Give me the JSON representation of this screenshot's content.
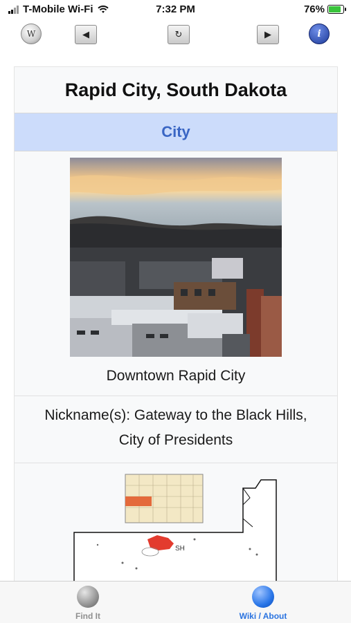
{
  "status": {
    "carrier": "T-Mobile Wi-Fi",
    "time": "7:32 PM",
    "battery": "76%"
  },
  "toolbar": {
    "wiki_icon": "wikipedia-globe-icon",
    "back_icon": "triangle-left-icon",
    "reload_icon": "reload-icon",
    "forward_icon": "triangle-right-icon",
    "info_icon": "info-icon"
  },
  "article": {
    "title": "Rapid City, South Dakota",
    "type": "City",
    "image_caption": "Downtown Rapid City",
    "nickname": "Nickname(s): Gateway to the Black Hills, City of Presidents"
  },
  "map": {
    "highlight_label": "SH"
  },
  "tabs": [
    {
      "label": "Find It",
      "icon": "globe-icon",
      "active": false
    },
    {
      "label": "Wiki / About",
      "icon": "globe-icon",
      "active": true
    }
  ],
  "colors": {
    "type_bar_bg": "#ccdcfb",
    "type_text": "#3a66c4",
    "active_tab": "#2a73e0",
    "map_highlight": "#e33b2e"
  }
}
